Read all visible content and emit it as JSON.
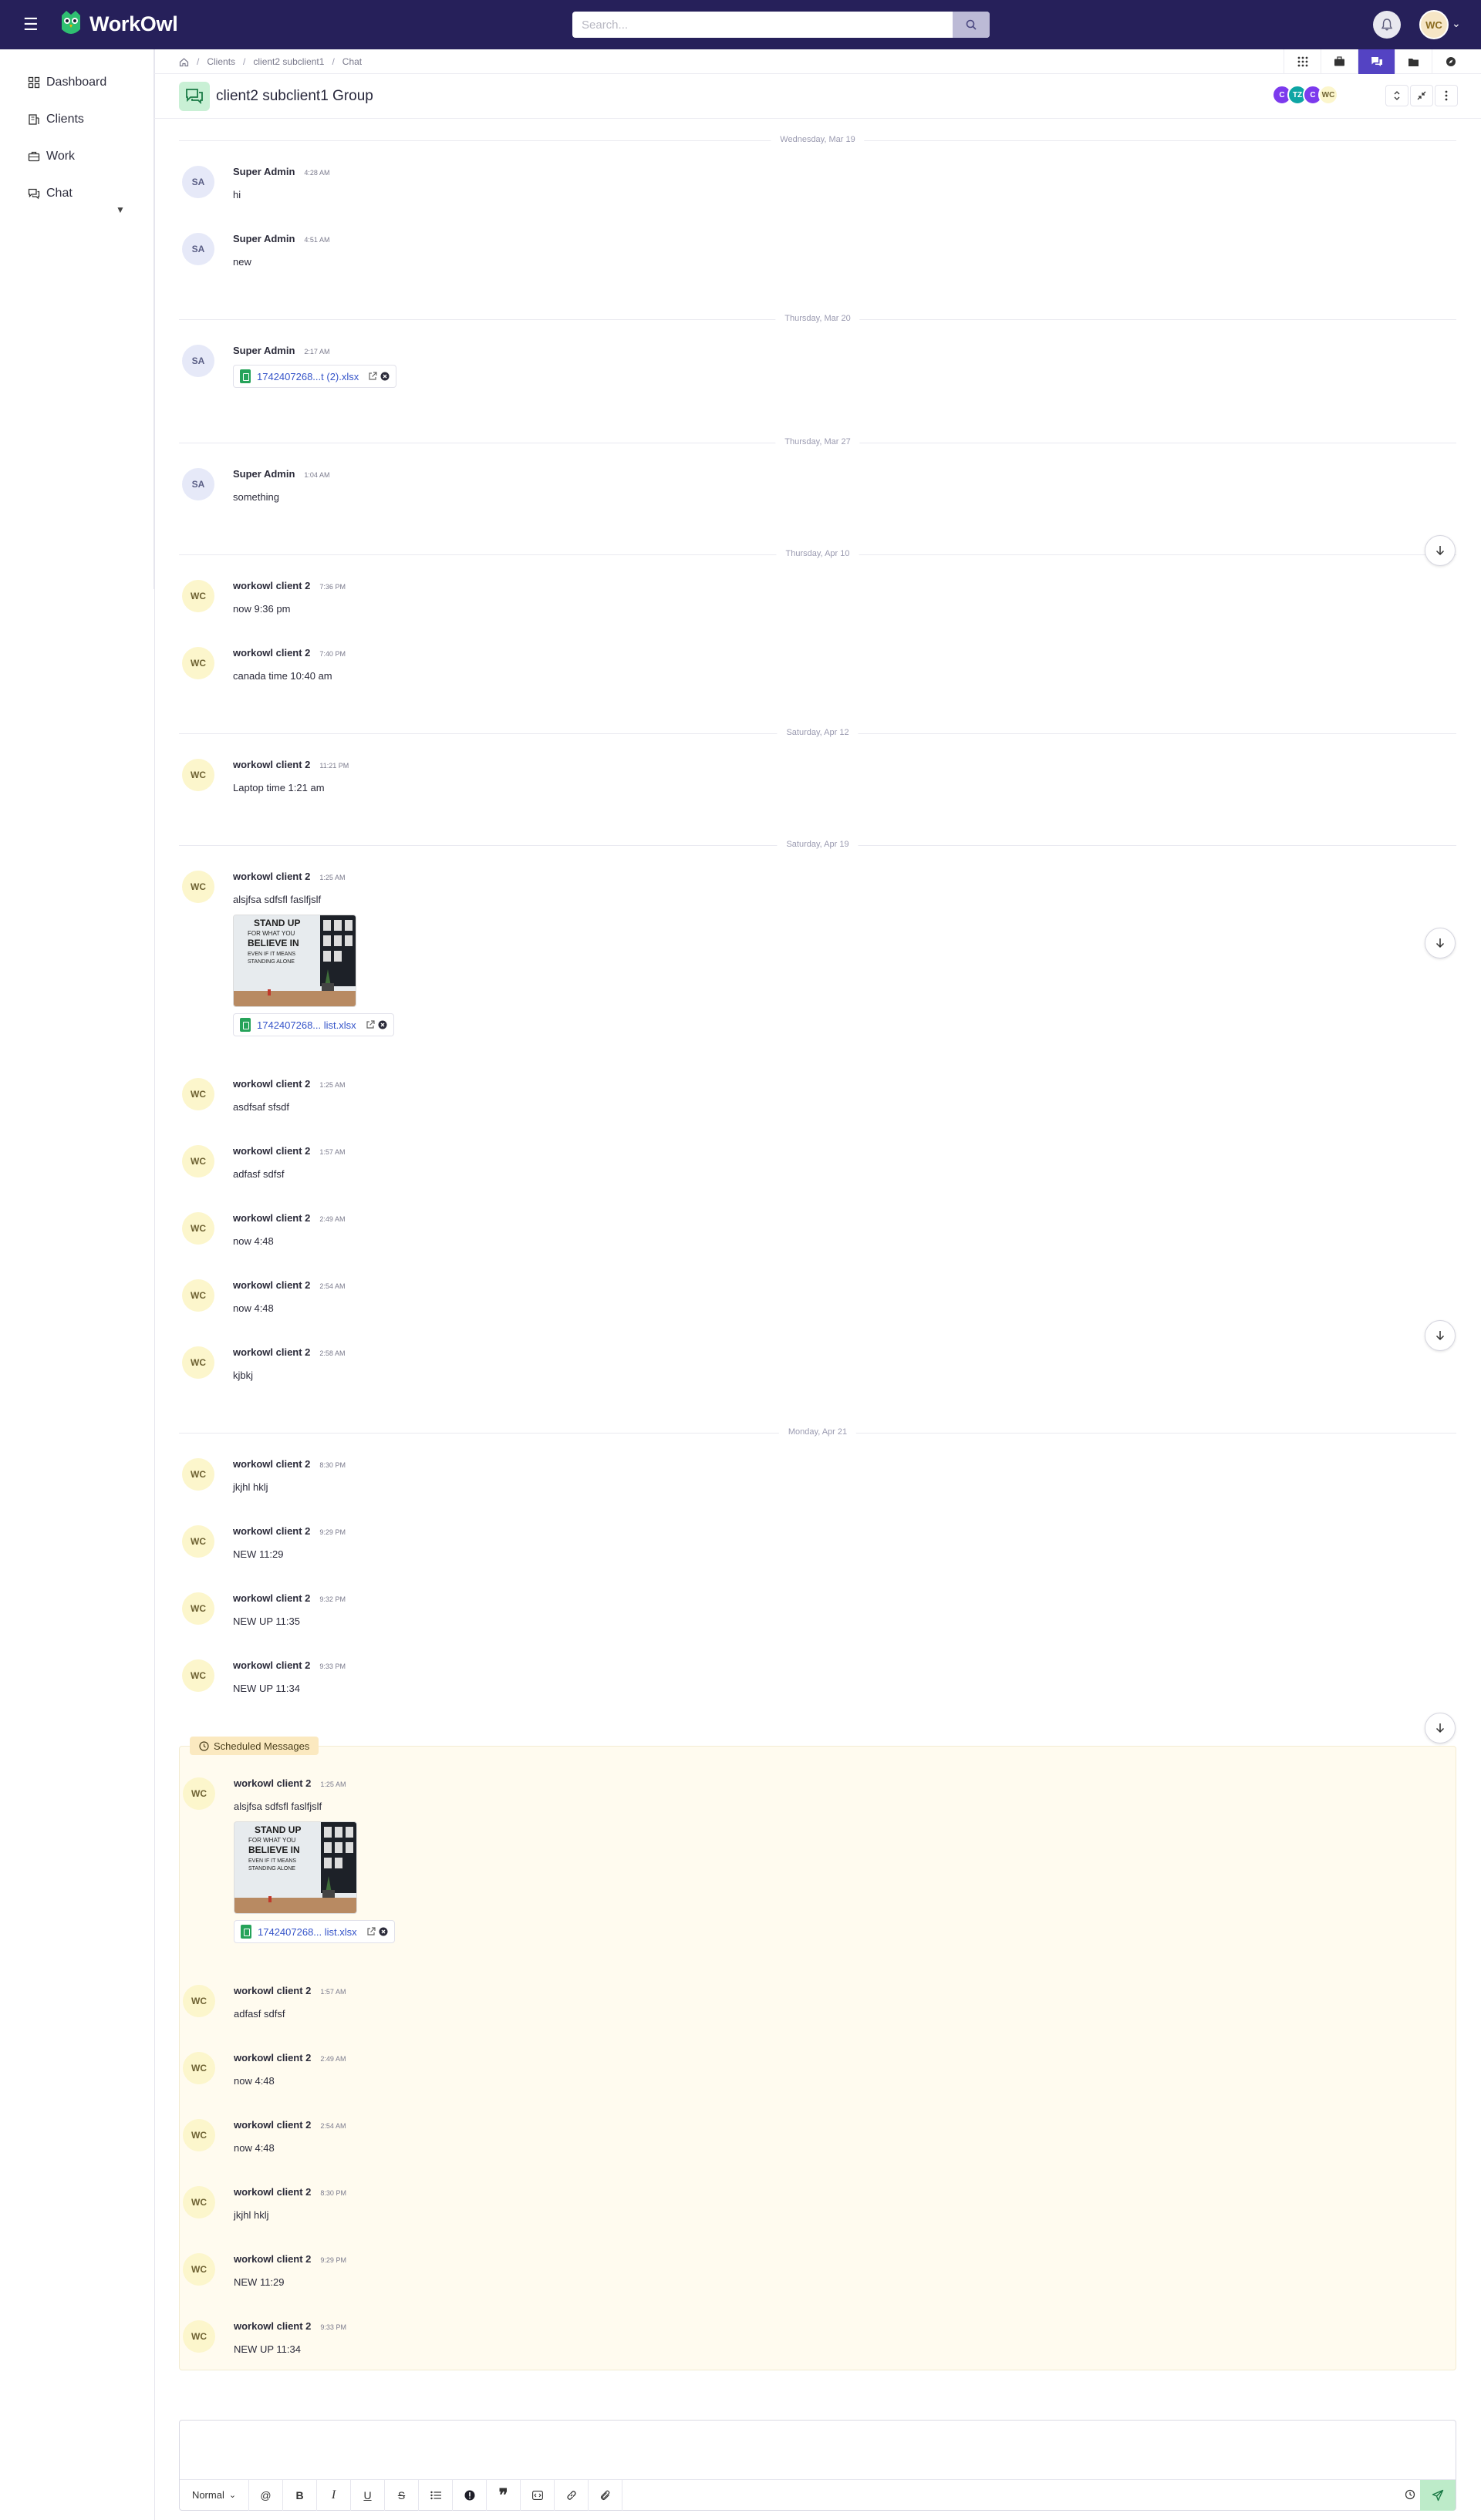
{
  "app": {
    "name": "WorkOwl",
    "user_initials": "WC"
  },
  "search": {
    "placeholder": "Search..."
  },
  "sidebar": {
    "items": [
      {
        "label": "Dashboard"
      },
      {
        "label": "Clients"
      },
      {
        "label": "Work"
      },
      {
        "label": "Chat"
      }
    ]
  },
  "breadcrumb": [
    "Clients",
    "client2 subclient1",
    "Chat"
  ],
  "chat": {
    "title": "client2 subclient1 Group",
    "members": [
      {
        "initials": "C",
        "color": "#7c3aed"
      },
      {
        "initials": "TZ",
        "color": "#0ea5a4"
      },
      {
        "initials": "C",
        "color": "#7c3aed"
      },
      {
        "initials": "WC",
        "color": "#fcf6cc"
      }
    ]
  },
  "dates": [
    "Wednesday, Mar 19",
    "Thursday, Mar 20",
    "Thursday, Mar 27",
    "Thursday, Apr 10",
    "Saturday, Apr 12",
    "Saturday, Apr 19",
    "Monday, Apr 21"
  ],
  "messages": [
    {
      "initials": "SA",
      "author": "Super Admin",
      "time": "4:28 AM",
      "text": "hi"
    },
    {
      "initials": "SA",
      "author": "Super Admin",
      "time": "4:51 AM",
      "text": "new"
    },
    {
      "initials": "SA",
      "author": "Super Admin",
      "time": "2:17 AM",
      "file": "1742407268...t (2).xlsx"
    },
    {
      "initials": "SA",
      "author": "Super Admin",
      "time": "1:04 AM",
      "text": "something"
    },
    {
      "initials": "WC",
      "author": "workowl client 2",
      "time": "7:36 PM",
      "text": "now 9:36 pm"
    },
    {
      "initials": "WC",
      "author": "workowl client 2",
      "time": "7:40 PM",
      "text": "canada time 10:40 am"
    },
    {
      "initials": "WC",
      "author": "workowl client 2",
      "time": "11:21 PM",
      "text": "Laptop time 1:21 am"
    },
    {
      "initials": "WC",
      "author": "workowl client 2",
      "time": "1:25 AM",
      "text": "alsjfsa sdfsfl faslfjslf",
      "file": "1742407268... list.xlsx"
    },
    {
      "initials": "WC",
      "author": "workowl client 2",
      "time": "1:25 AM",
      "text": "asdfsaf sfsdf"
    },
    {
      "initials": "WC",
      "author": "workowl client 2",
      "time": "1:57 AM",
      "text": "adfasf sdfsf"
    },
    {
      "initials": "WC",
      "author": "workowl client 2",
      "time": "2:49 AM",
      "text": "now 4:48"
    },
    {
      "initials": "WC",
      "author": "workowl client 2",
      "time": "2:54 AM",
      "text": "now 4:48"
    },
    {
      "initials": "WC",
      "author": "workowl client 2",
      "time": "2:58 AM",
      "text": "kjbkj"
    },
    {
      "initials": "WC",
      "author": "workowl client 2",
      "time": "8:30 PM",
      "text": "jkjhl hklj"
    },
    {
      "initials": "WC",
      "author": "workowl client 2",
      "time": "9:29 PM",
      "text": "NEW 11:29"
    },
    {
      "initials": "WC",
      "author": "workowl client 2",
      "time": "9:32 PM",
      "text": "NEW UP 11:35"
    },
    {
      "initials": "WC",
      "author": "workowl client 2",
      "time": "9:33 PM",
      "text": "NEW UP 11:34"
    }
  ],
  "image_text": [
    "STAND UP",
    "FOR WHAT YOU",
    "BELIEVE IN",
    "EVEN IF IT MEANS",
    "STANDING ALONE"
  ],
  "scheduled": {
    "label": "Scheduled Messages",
    "messages": [
      {
        "initials": "WC",
        "author": "workowl client 2",
        "time": "1:25 AM",
        "text": "alsjfsa sdfsfl faslfjslf",
        "file": "1742407268... list.xlsx"
      },
      {
        "initials": "WC",
        "author": "workowl client 2",
        "time": "1:57 AM",
        "text": "adfasf sdfsf"
      },
      {
        "initials": "WC",
        "author": "workowl client 2",
        "time": "2:49 AM",
        "text": "now 4:48"
      },
      {
        "initials": "WC",
        "author": "workowl client 2",
        "time": "2:54 AM",
        "text": "now 4:48"
      },
      {
        "initials": "WC",
        "author": "workowl client 2",
        "time": "8:30 PM",
        "text": "jkjhl hklj"
      },
      {
        "initials": "WC",
        "author": "workowl client 2",
        "time": "9:29 PM",
        "text": "NEW 11:29"
      },
      {
        "initials": "WC",
        "author": "workowl client 2",
        "time": "9:33 PM",
        "text": "NEW UP 11:34"
      }
    ]
  },
  "editor": {
    "format": "Normal"
  },
  "colors": {
    "topbar": "#26205a",
    "accent": "#5443c3",
    "scheduled_bg": "#fffbef",
    "file_icon": "#26a35a",
    "send": "#bdebc9"
  }
}
